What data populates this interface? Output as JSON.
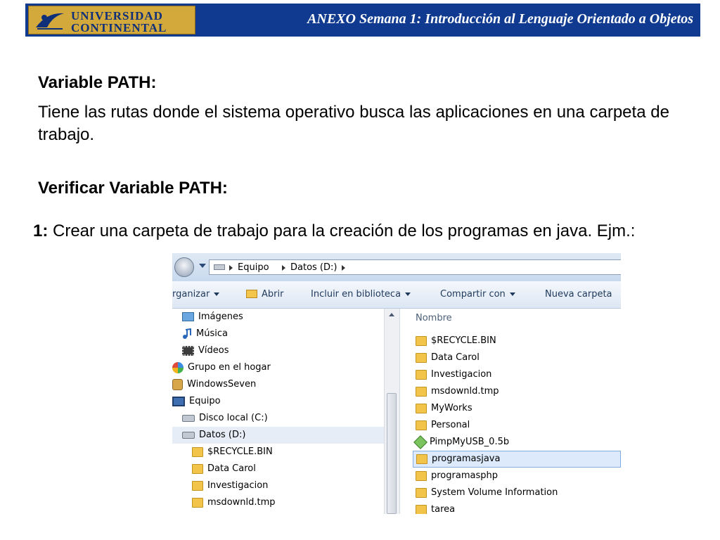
{
  "header": {
    "logo_line1": "UNIVERSIDAD",
    "logo_line2": "CONTINENTAL",
    "title": "ANEXO Semana 1: Introducción al Lenguaje Orientado a Objetos",
    "band_color": "#0f3a8f",
    "logo_color": "#d3a93b"
  },
  "document": {
    "heading_path": "Variable PATH:",
    "paragraph": "Tiene las rutas donde el sistema operativo busca las aplicaciones en una carpeta de trabajo.",
    "heading_verify": "Verificar Variable PATH:",
    "step_number": "1:",
    "step_text": " Crear una carpeta de trabajo para la creación de los programas en java. Ejm.:"
  },
  "explorer": {
    "breadcrumb": [
      "Equipo",
      "Datos (D:)"
    ],
    "toolbar": {
      "organize": "rganizar",
      "open": "Abrir",
      "include": "Incluir en biblioteca",
      "share": "Compartir con",
      "new_folder": "Nueva carpeta"
    },
    "nav_items": [
      {
        "label": "Imágenes",
        "icon": "image-icon"
      },
      {
        "label": "Música",
        "icon": "music-icon"
      },
      {
        "label": "Vídeos",
        "icon": "video-icon"
      },
      {
        "label": "Grupo en el hogar",
        "icon": "homegroup-icon"
      },
      {
        "label": "WindowsSeven",
        "icon": "user-icon"
      },
      {
        "label": "Equipo",
        "icon": "computer-icon"
      },
      {
        "label": "Disco local (C:)",
        "icon": "drive-icon"
      },
      {
        "label": "Datos (D:)",
        "icon": "drive-icon",
        "selected": true
      },
      {
        "label": "$RECYCLE.BIN",
        "icon": "folder-icon"
      },
      {
        "label": "Data Carol",
        "icon": "folder-icon"
      },
      {
        "label": "Investigacion",
        "icon": "folder-icon"
      },
      {
        "label": "msdownld.tmp",
        "icon": "folder-icon"
      }
    ],
    "column_header": "Nombre",
    "files": [
      {
        "label": "$RECYCLE.BIN",
        "icon": "folder-icon"
      },
      {
        "label": "Data Carol",
        "icon": "folder-icon"
      },
      {
        "label": "Investigacion",
        "icon": "folder-icon"
      },
      {
        "label": "msdownld.tmp",
        "icon": "folder-icon"
      },
      {
        "label": "MyWorks",
        "icon": "folder-icon"
      },
      {
        "label": "Personal",
        "icon": "folder-icon"
      },
      {
        "label": "PimpMyUSB_0.5b",
        "icon": "usb-app-icon"
      },
      {
        "label": "programasjava",
        "icon": "folder-icon",
        "selected": true
      },
      {
        "label": "programasphp",
        "icon": "folder-icon"
      },
      {
        "label": "System Volume Information",
        "icon": "folder-icon"
      },
      {
        "label": "tarea",
        "icon": "folder-icon"
      }
    ],
    "selection_color": "#dceafc"
  }
}
